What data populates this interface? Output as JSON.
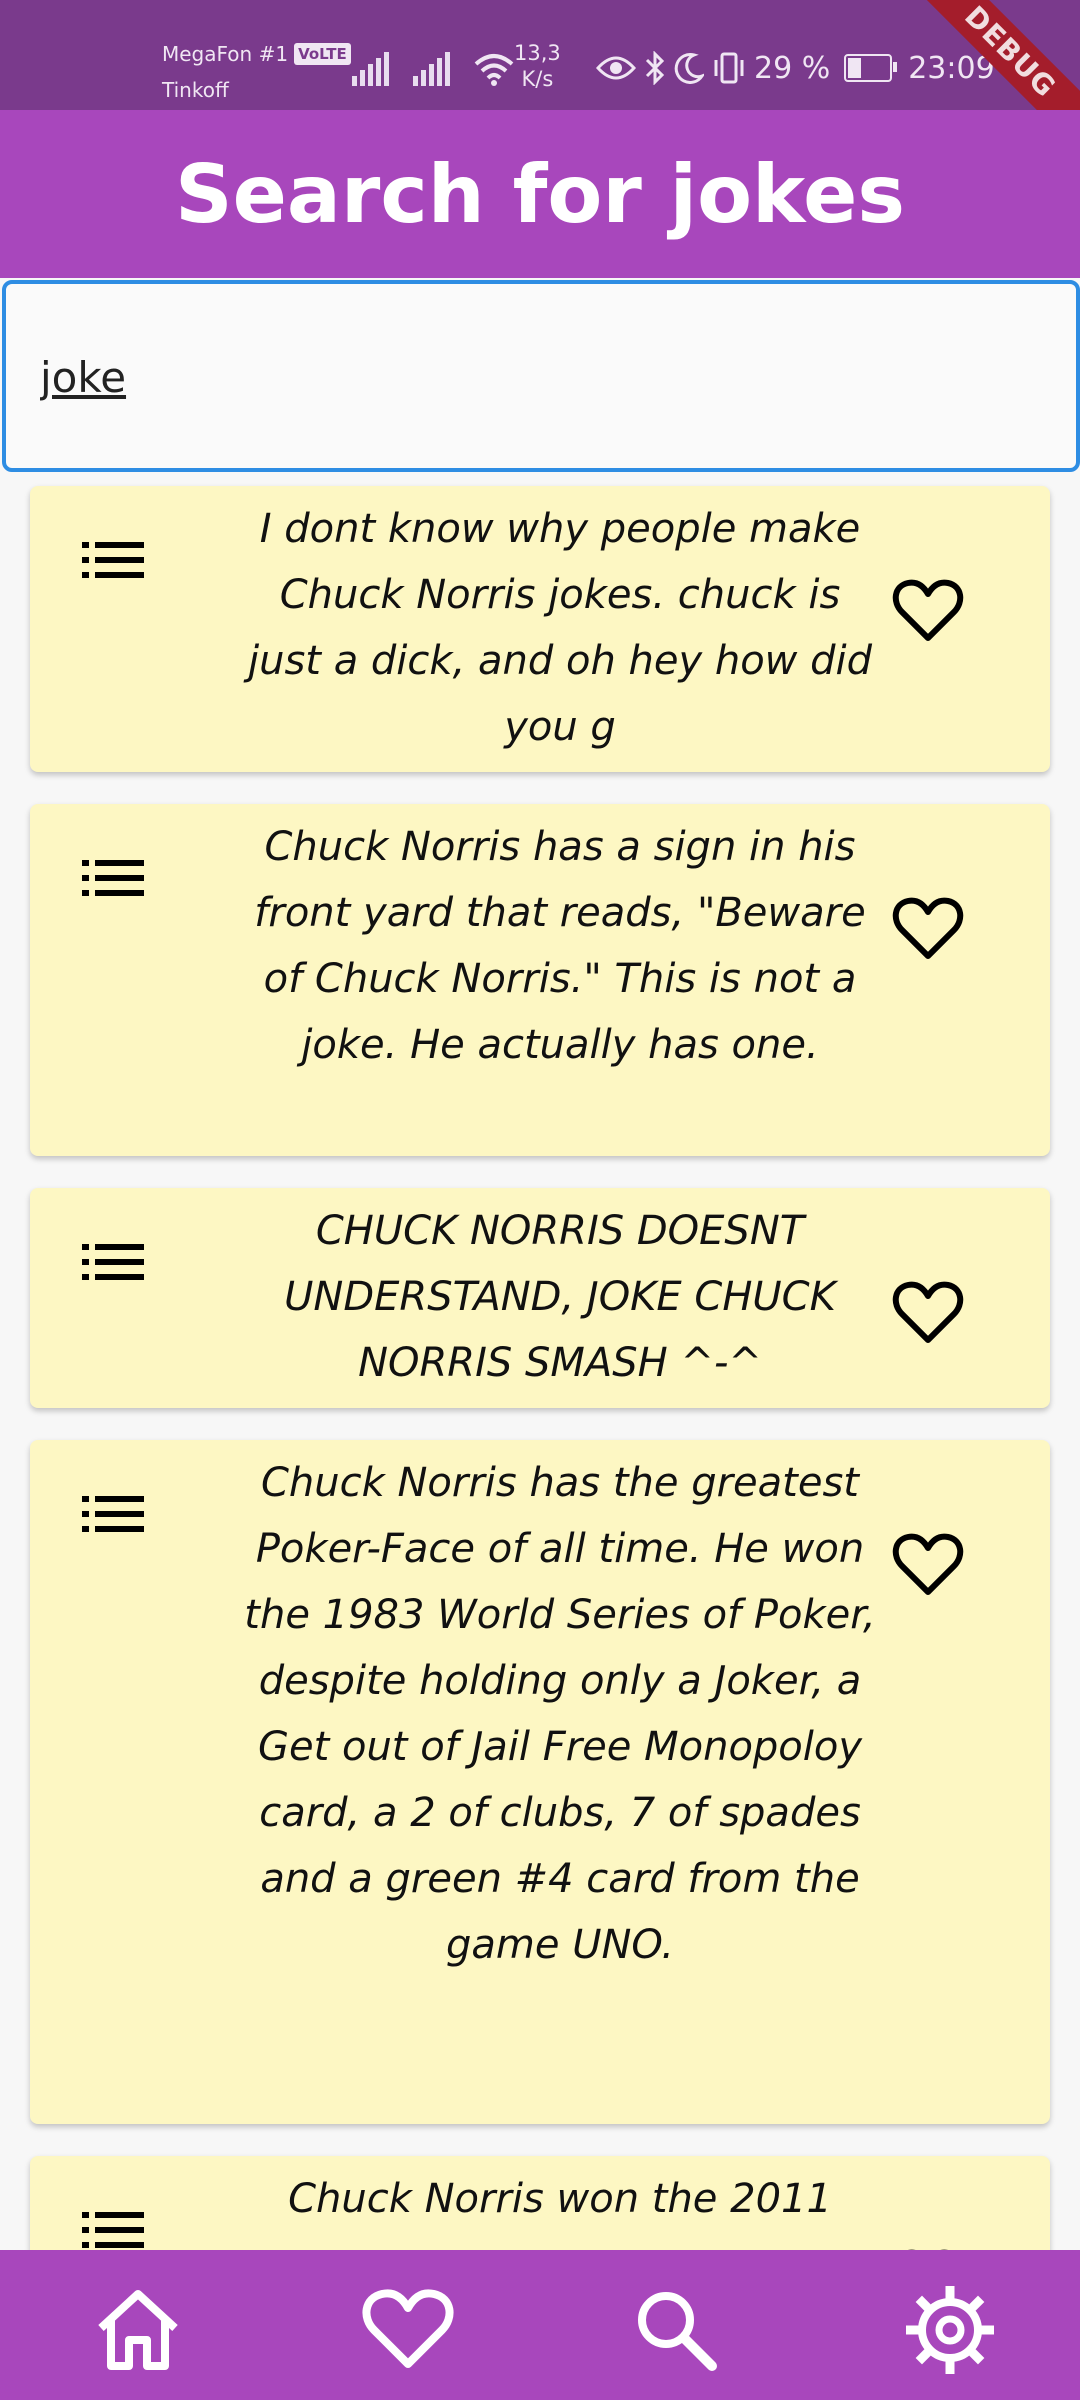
{
  "status": {
    "carrier1": "MegaFon #1",
    "volte": "VoLTE",
    "carrier2": "Tinkoff",
    "speed_value": "13,3",
    "speed_unit": "K/s",
    "battery": "29 %",
    "battery_level": 0.29,
    "time": "23:09",
    "debug_banner": "DEBUG"
  },
  "appbar": {
    "title": "Search for jokes"
  },
  "search": {
    "value": "joke"
  },
  "jokes": [
    {
      "text": "I dont know why people make Chuck Norris jokes. chuck is just a dick, and oh hey how did you g"
    },
    {
      "text": "Chuck Norris has a sign in his front yard that reads, \"Beware of Chuck Norris.\" This is not a joke. He actually has one."
    },
    {
      "text": "CHUCK NORRIS DOESNT UNDERSTAND, JOKE CHUCK NORRIS SMASH ^-^"
    },
    {
      "text": "Chuck Norris has the greatest Poker-Face of all time. He won the 1983 World Series of Poker, despite holding only a Joker, a Get out of Jail Free Monopoloy card, a 2 of clubs, 7 of spades and a green #4 card from the game UNO."
    },
    {
      "text": "Chuck Norris won the 2011"
    }
  ],
  "colors": {
    "statusbar": "#7a3a8c",
    "primary": "#a847bc",
    "card": "#fdf7c3",
    "search_border": "#2e8de3"
  },
  "nav": [
    "home-icon",
    "heart-icon",
    "search-icon",
    "settings-icon"
  ]
}
